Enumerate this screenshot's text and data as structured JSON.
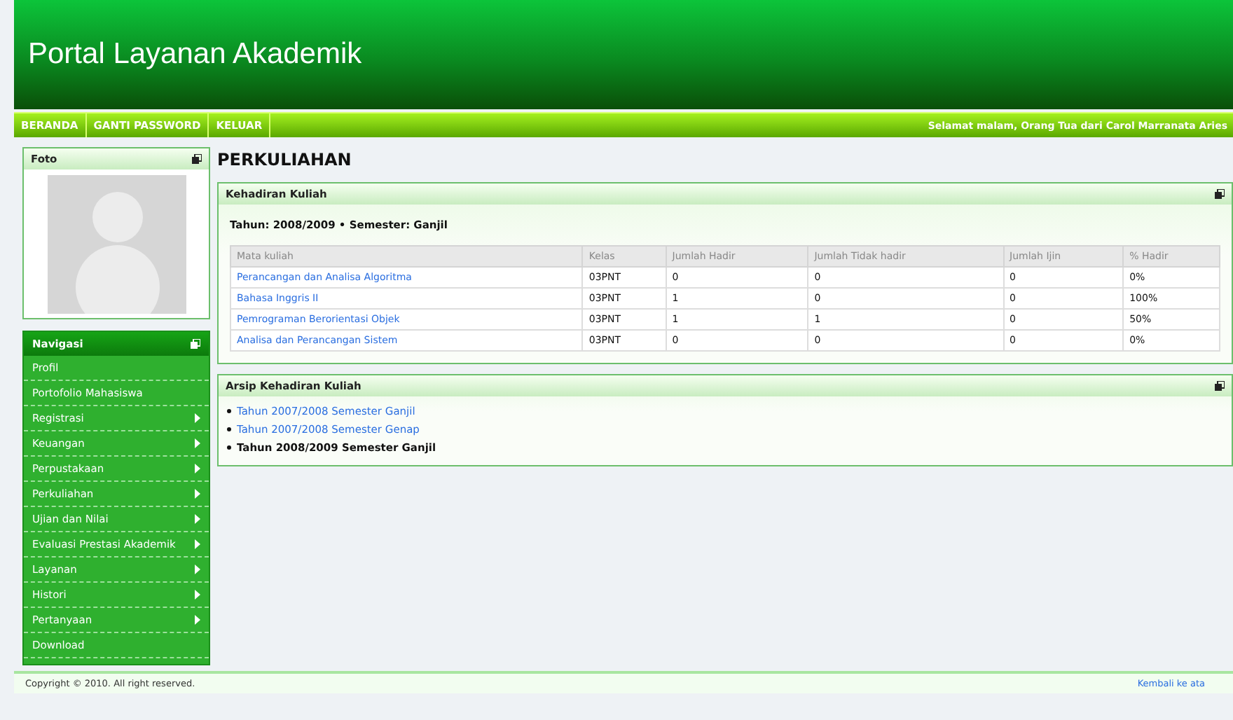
{
  "header": {
    "title": "Portal Layanan Akademik"
  },
  "top_menu": [
    "BERANDA",
    "GANTI PASSWORD",
    "KELUAR"
  ],
  "greeting": "Selamat malam, Orang Tua dari Carol Marranata Aries",
  "photo_panel": {
    "title": "Foto"
  },
  "nav_panel": {
    "title": "Navigasi",
    "items": [
      {
        "label": "Profil",
        "has_submenu": false
      },
      {
        "label": "Portofolio Mahasiswa",
        "has_submenu": false
      },
      {
        "label": "Registrasi",
        "has_submenu": true
      },
      {
        "label": "Keuangan",
        "has_submenu": true
      },
      {
        "label": "Perpustakaan",
        "has_submenu": true
      },
      {
        "label": "Perkuliahan",
        "has_submenu": true
      },
      {
        "label": "Ujian dan Nilai",
        "has_submenu": true
      },
      {
        "label": "Evaluasi Prestasi Akademik",
        "has_submenu": true
      },
      {
        "label": "Layanan",
        "has_submenu": true
      },
      {
        "label": "Histori",
        "has_submenu": true
      },
      {
        "label": "Pertanyaan",
        "has_submenu": true
      },
      {
        "label": "Download",
        "has_submenu": false
      }
    ]
  },
  "page_title": "PERKULIAHAN",
  "attendance": {
    "title": "Kehadiran Kuliah",
    "period": "Tahun: 2008/2009 • Semester: Ganjil",
    "columns": [
      "Mata kuliah",
      "Kelas",
      "Jumlah Hadir",
      "Jumlah Tidak hadir",
      "Jumlah Ijin",
      "% Hadir"
    ],
    "rows": [
      [
        "Perancangan dan Analisa Algoritma",
        "03PNT",
        "0",
        "0",
        "0",
        "0%"
      ],
      [
        "Bahasa Inggris II",
        "03PNT",
        "1",
        "0",
        "0",
        "100%"
      ],
      [
        "Pemrograman Berorientasi Objek",
        "03PNT",
        "1",
        "1",
        "0",
        "50%"
      ],
      [
        "Analisa dan Perancangan Sistem",
        "03PNT",
        "0",
        "0",
        "0",
        "0%"
      ]
    ]
  },
  "archive": {
    "title": "Arsip Kehadiran Kuliah",
    "items": [
      {
        "label": "Tahun 2007/2008 Semester Ganjil",
        "selected": false
      },
      {
        "label": "Tahun 2007/2008 Semester Genap",
        "selected": false
      },
      {
        "label": "Tahun 2008/2009 Semester Ganjil",
        "selected": true
      }
    ]
  },
  "footer": {
    "copyright": "Copyright © 2010. All right reserved.",
    "back_to_top": "Kembali ke ata"
  }
}
